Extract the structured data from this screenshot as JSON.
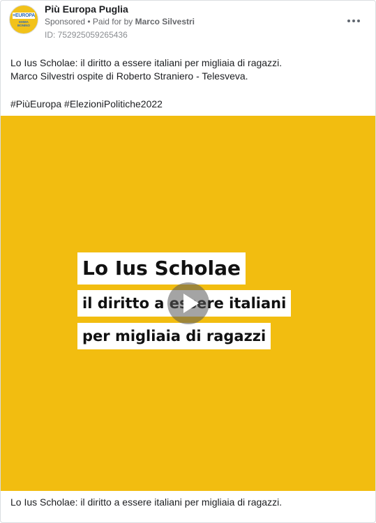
{
  "ad": {
    "page_name": "Più Europa Puglia",
    "sponsored_label": "Sponsored",
    "separator": " • ",
    "paid_for_prefix": "Paid for by ",
    "paid_for_name": "Marco Silvestri",
    "ad_id": "ID: 752925059265436",
    "avatar_logo_top": "+EUROPA",
    "avatar_logo_bottom": "EMMA BONINO",
    "body_lines": [
      "Lo Ius Scholae: il diritto a essere italiani per migliaia di ragazzi.",
      "Marco Silvestri ospite di Roberto Straniero - Telesveva."
    ],
    "hashtags": "#PiùEuropa #ElezioniPolitiche2022",
    "video": {
      "title_line_1": "Lo Ius Scholae",
      "title_line_2": "il diritto a essere italiani",
      "title_line_3": "per migliaia di ragazzi",
      "background_color": "#f2bd10",
      "play_icon": "play-icon"
    },
    "caption": "Lo Ius Scholae: il diritto a essere italiani per migliaia di ragazzi."
  },
  "icons": {
    "more": "more-horizontal-icon"
  }
}
